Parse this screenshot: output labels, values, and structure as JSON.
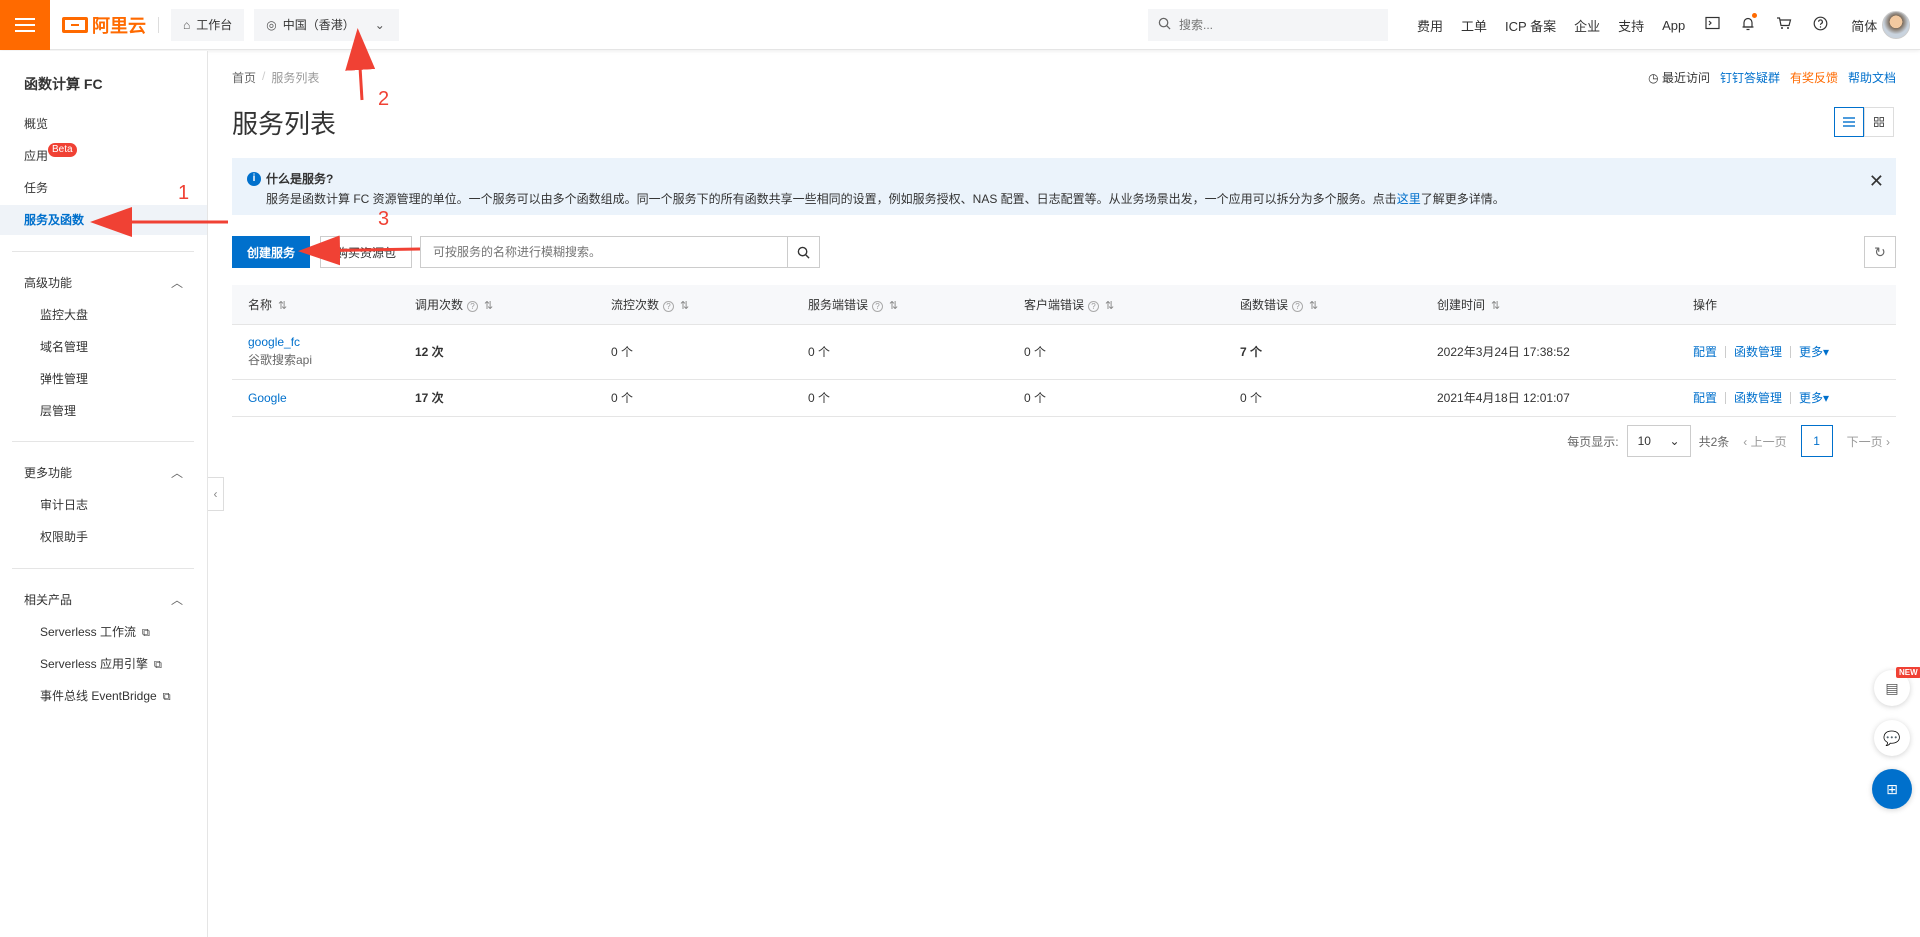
{
  "topbar": {
    "logo_text": "阿里云",
    "workbench_label": "工作台",
    "region_label": "中国（香港）",
    "search_placeholder": "搜索...",
    "links": [
      "费用",
      "工单",
      "ICP 备案",
      "企业",
      "支持",
      "App"
    ],
    "lang_label": "简体",
    "icons": [
      "terminal-icon",
      "bell-icon",
      "cart-icon",
      "help-icon"
    ]
  },
  "sidebar": {
    "title": "函数计算 FC",
    "items": [
      {
        "label": "概览"
      },
      {
        "label": "应用",
        "badge": "Beta"
      },
      {
        "label": "任务"
      },
      {
        "label": "服务及函数",
        "active": true
      }
    ],
    "groups": [
      {
        "label": "高级功能",
        "items": [
          "监控大盘",
          "域名管理",
          "弹性管理",
          "层管理"
        ]
      },
      {
        "label": "更多功能",
        "items": [
          "审计日志",
          "权限助手"
        ]
      },
      {
        "label": "相关产品",
        "items": [
          "Serverless 工作流",
          "Serverless 应用引擎",
          "事件总线 EventBridge"
        ]
      }
    ]
  },
  "breadcrumb": [
    "首页",
    "服务列表"
  ],
  "header_links": {
    "recent": "最近访问",
    "dingtalk": "钉钉答疑群",
    "feedback": "有奖反馈",
    "docs": "帮助文档"
  },
  "page_title": "服务列表",
  "info": {
    "title": "什么是服务?",
    "text_before": "服务是函数计算 FC 资源管理的单位。一个服务可以由多个函数组成。同一个服务下的所有函数共享一些相同的设置，例如服务授权、NAS 配置、日志配置等。从业务场景出发，一个应用可以拆分为多个服务。点击",
    "link": "这里",
    "text_after": "了解更多详情。"
  },
  "toolbar": {
    "create_label": "创建服务",
    "buy_label": "购买资源包",
    "search_placeholder": "可按服务的名称进行模糊搜索。"
  },
  "table": {
    "headers": [
      "名称",
      "调用次数",
      "流控次数",
      "服务端错误",
      "客户端错误",
      "函数错误",
      "创建时间",
      "操作"
    ],
    "rows": [
      {
        "name": "google_fc",
        "desc": "谷歌搜索api",
        "calls": "12 次",
        "throttle": "0 个",
        "server_err": "0 个",
        "client_err": "0 个",
        "func_err": "7 个",
        "created": "2022年3月24日 17:38:52"
      },
      {
        "name": "Google",
        "desc": "",
        "calls": "17 次",
        "throttle": "0 个",
        "server_err": "0 个",
        "client_err": "0 个",
        "func_err": "0 个",
        "created": "2021年4月18日 12:01:07"
      }
    ],
    "ops": [
      "配置",
      "函数管理",
      "更多"
    ]
  },
  "pagination": {
    "page_size_label": "每页显示:",
    "page_size": "10",
    "total": "共2条",
    "prev": "上一页",
    "current": "1",
    "next": "下一页"
  },
  "annotations": [
    "1",
    "2",
    "3"
  ],
  "floating": {
    "new_badge": "NEW"
  },
  "colors": {
    "brand": "#ff6a00",
    "primary": "#0070cc",
    "error": "#f04134",
    "annotation": "#f04134"
  }
}
